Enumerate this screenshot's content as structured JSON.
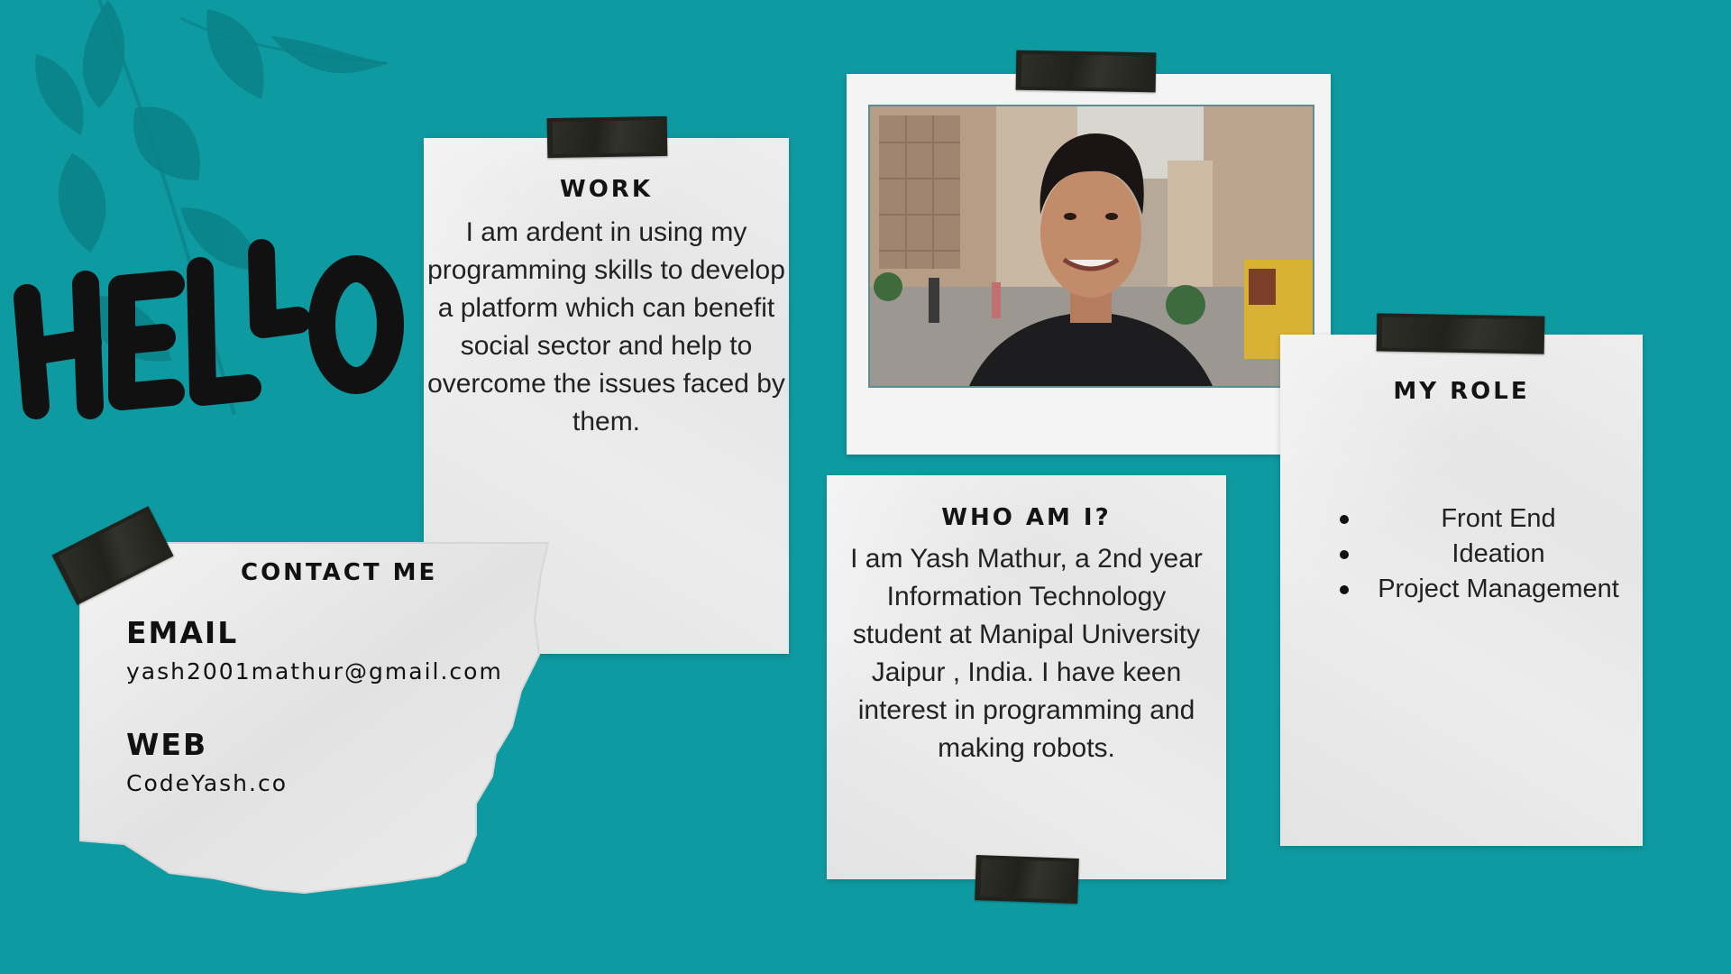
{
  "hello": {
    "text": "HELLO"
  },
  "work": {
    "title": "WORK",
    "lines": [
      "I am ardent in using my",
      "programming skills to develop",
      "a platform which can benefit",
      "social sector and help to",
      "overcome the issues faced by",
      "them."
    ]
  },
  "who": {
    "title": "WHO AM I?",
    "lines": [
      "I am Yash Mathur,  a 2nd year",
      "Information Technology",
      "student at  Manipal University",
      "Jaipur , India. I have keen",
      "interest in programming and",
      "making robots."
    ]
  },
  "role": {
    "title": "MY ROLE",
    "items": [
      "Front End",
      "Ideation",
      "Project Management"
    ]
  },
  "contact": {
    "title": "CONTACT ME",
    "email_label": "EMAIL",
    "email_value": "yash2001mathur@gmail.com",
    "web_label": "WEB",
    "web_value": "CodeYash.co"
  },
  "colors": {
    "background": "#0e9aa1",
    "paper": "#ececec",
    "tape": "#22221c",
    "text": "#141414"
  },
  "icons": [
    "leaf-shadow-icon",
    "tape-strip-icon",
    "profile-photo"
  ]
}
